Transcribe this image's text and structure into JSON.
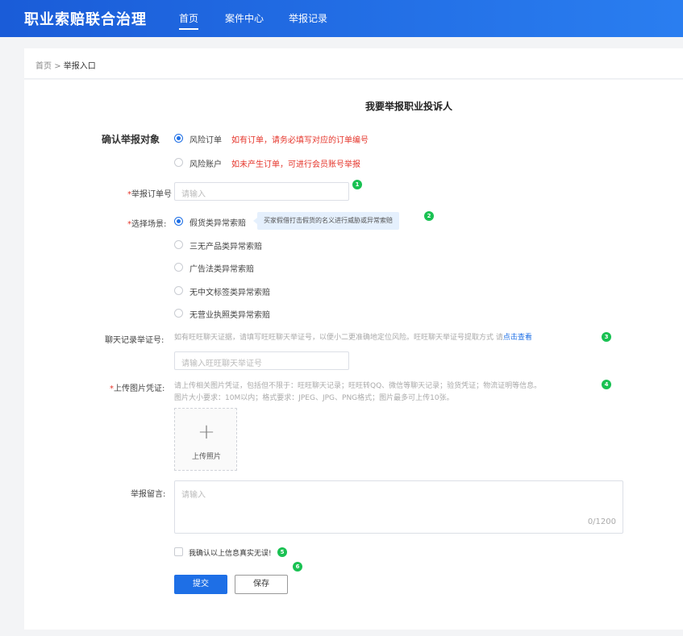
{
  "header": {
    "brand": "职业索赔联合治理",
    "nav": [
      "首页",
      "案件中心",
      "举报记录"
    ]
  },
  "breadcrumb": {
    "home": "首页",
    "sep": ">",
    "current": "举报入口"
  },
  "page_title": "我要举报职业投诉人",
  "target": {
    "label": "确认举报对象",
    "options": [
      {
        "label": "风险订单",
        "note": "如有订单，请务必填写对应的订单编号",
        "selected": true
      },
      {
        "label": "风险账户",
        "note": "如未产生订单，可进行会员账号举报",
        "selected": false
      }
    ]
  },
  "order": {
    "required": "*",
    "label": "举报订单号",
    "placeholder": "请输入"
  },
  "scene": {
    "required": "*",
    "label": "选择场景:",
    "tip": "买家假借打击假货的名义进行威胁或异常索赔",
    "options": [
      "假货类异常索赔",
      "三无产品类异常索赔",
      "广告法类异常索赔",
      "无中文标签类异常索赔",
      "无营业执照类异常索赔"
    ],
    "selected_index": 0
  },
  "chat": {
    "label": "聊天记录举证号:",
    "hint": "如有旺旺聊天证据，请填写旺旺聊天举证号，以便小二更准确地定位风险。旺旺聊天举证号提取方式 请",
    "link": "点击查看",
    "placeholder": "请输入旺旺聊天举证号"
  },
  "upload": {
    "required": "*",
    "label": "上传图片凭证:",
    "hint1": "请上传相关图片凭证，包括但不限于：旺旺聊天记录；旺旺转QQ、微信等聊天记录；验货凭证；物流证明等信息。",
    "hint2": "图片大小要求：10M以内；格式要求：JPEG、JPG、PNG格式；图片最多可上传10张。",
    "button_label": "上传照片"
  },
  "message": {
    "label": "举报留言:",
    "placeholder": "请输入",
    "counter": "0/1200"
  },
  "confirm": {
    "label": "我确认以上信息真实无误!",
    "checked": false
  },
  "actions": {
    "submit": "提交",
    "save": "保存"
  },
  "badges": [
    "1",
    "2",
    "3",
    "4",
    "5",
    "6"
  ],
  "colors": {
    "accent": "#1e6fe6",
    "required": "#e5352b",
    "badge": "#19c152"
  }
}
